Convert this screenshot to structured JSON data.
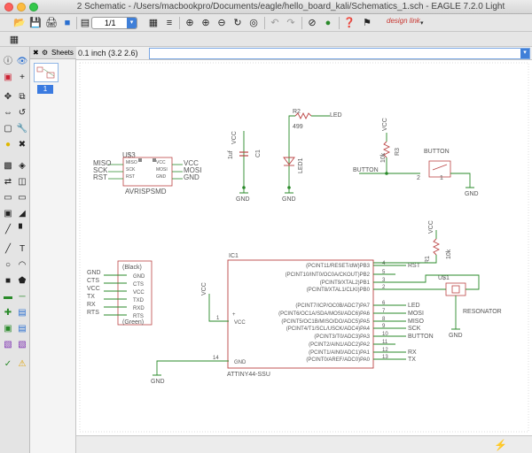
{
  "window": {
    "title": "2 Schematic - /Users/macbookpro/Documents/eagle/hello_board_kali/Schematics_1.sch - EAGLE 7.2.0 Light"
  },
  "toolbar": {
    "sheet_select": "1/1",
    "brand": "design link"
  },
  "sheets_panel": {
    "title": "Sheets",
    "sheet_number": "1"
  },
  "status": {
    "grid_coords": "0.1 inch (3.2 2.6)",
    "command": ""
  },
  "schematic": {
    "avrisp": {
      "name": "U$3",
      "value": "AVRISPSMD",
      "left_pins": [
        "MISO",
        "SCK",
        "RST"
      ],
      "inner_left": [
        "MISO",
        "SCK",
        "RST"
      ],
      "inner_right": [
        "VCC",
        "MOSI",
        "GND"
      ],
      "right_pins": [
        "VCC",
        "MOSI",
        "GND"
      ]
    },
    "cap": {
      "value": "1uf",
      "name": "C1",
      "net": "VCC",
      "gnd": "GND"
    },
    "led": {
      "res_name": "R2",
      "res_value": "499",
      "net": "LED",
      "led_name": "LED1",
      "gnd": "GND"
    },
    "button": {
      "net": "VCC",
      "res_name": "R3",
      "res_value": "10k",
      "label": "BUTTON",
      "left_net": "BUTTON",
      "pin2": "2",
      "pin1": "1",
      "gnd": "GND"
    },
    "ftdi": {
      "top_label": "(Black)",
      "bottom_label": "(Green)",
      "left_pins": [
        "GND",
        "CTS",
        "VCC",
        "TX",
        "RX",
        "RTS"
      ],
      "inner_pins": [
        "GND",
        "CTS",
        "VCC",
        "TXD",
        "RXD",
        "RTS"
      ]
    },
    "ic": {
      "name": "IC1",
      "value": "ATTINY44-SSU",
      "vcc_net": "VCC",
      "vcc_pin": "1",
      "vcc_label": "VCC",
      "gnd_pin": "14",
      "gnd_label": "GND",
      "gnd_net": "GND",
      "pins": [
        {
          "label": "(PCINT11/RESET/dW)PB3",
          "num": "4",
          "net": "RST"
        },
        {
          "label": "(PCINT10/INT0/OC0A/CKOUT)PB2",
          "num": "5",
          "net": ""
        },
        {
          "label": "(PCINT9/XTAL2)PB1",
          "num": "3",
          "net": ""
        },
        {
          "label": "(PCINT8/XTAL1/CLKI)PB0",
          "num": "2",
          "net": ""
        },
        {
          "label": "(PCINT7/ICP/OC0B/ADC7)PA7",
          "num": "6",
          "net": "LED"
        },
        {
          "label": "(PCINT6/OC1A/SDA/MOSI/ADC6)PA6",
          "num": "7",
          "net": "MOSI"
        },
        {
          "label": "(PCINT5/OC1B/MISO/DO/ADC5)PA5",
          "num": "8",
          "net": "MISO"
        },
        {
          "label": "(PCINT4/T1/SCL/USCK/ADC4)PA4",
          "num": "9",
          "net": "SCK"
        },
        {
          "label": "(PCINT3/T0/ADC3)PA3",
          "num": "10",
          "net": "BUTTON"
        },
        {
          "label": "(PCINT2/AIN1/ADC2)PA2",
          "num": "11",
          "net": ""
        },
        {
          "label": "(PCINT1/AIN0/ADC1)PA1",
          "num": "12",
          "net": "RX"
        },
        {
          "label": "(PCINT0/AREF/ADC0)PA0",
          "num": "13",
          "net": "TX"
        }
      ]
    },
    "resonator": {
      "vcc": "VCC",
      "res_name": "R1",
      "res_value": "10k",
      "name": "U$1",
      "value": "RESONATOR",
      "gnd": "GND"
    }
  }
}
